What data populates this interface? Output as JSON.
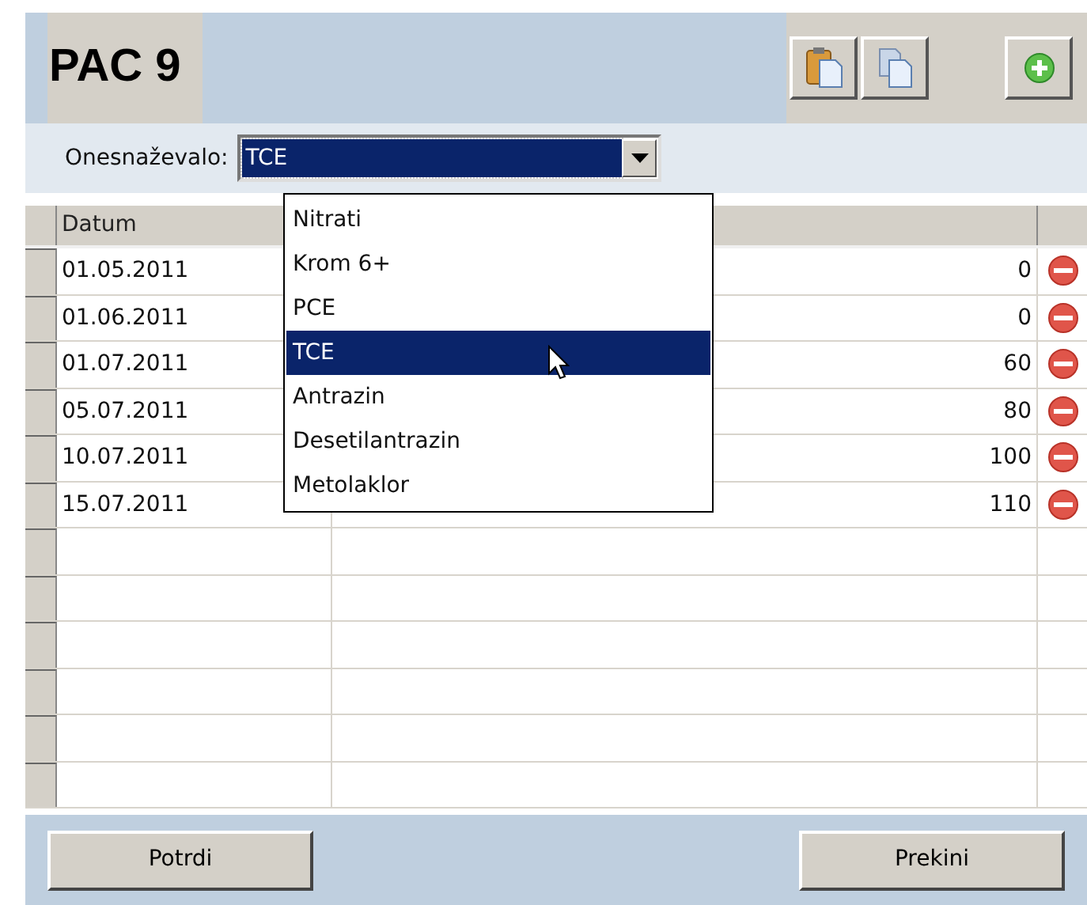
{
  "title": "PAC 9",
  "toolbar": [
    {
      "kind": "paste"
    },
    {
      "kind": "copy"
    },
    {
      "kind": "add"
    }
  ],
  "filter": {
    "label": "Onesnaževalo:",
    "value": "TCE",
    "expanded": true,
    "options": [
      {
        "label": "Nitrati",
        "selected": false
      },
      {
        "label": "Krom 6+",
        "selected": false
      },
      {
        "label": "PCE",
        "selected": false
      },
      {
        "label": "TCE",
        "selected": true
      },
      {
        "label": "Antrazin",
        "selected": false
      },
      {
        "label": "Desetilantrazin",
        "selected": false
      },
      {
        "label": "Metolaklor",
        "selected": false
      }
    ]
  },
  "table": {
    "columns": [
      "Datum"
    ],
    "rows": [
      {
        "date": "01.05.2011",
        "value": "0"
      },
      {
        "date": "01.06.2011",
        "value": "0"
      },
      {
        "date": "01.07.2011",
        "value": "60"
      },
      {
        "date": "05.07.2011",
        "value": "80"
      },
      {
        "date": "10.07.2011",
        "value": "100"
      },
      {
        "date": "15.07.2011",
        "value": "110"
      }
    ]
  },
  "buttons": [
    "Potrdi",
    "Prekini"
  ]
}
